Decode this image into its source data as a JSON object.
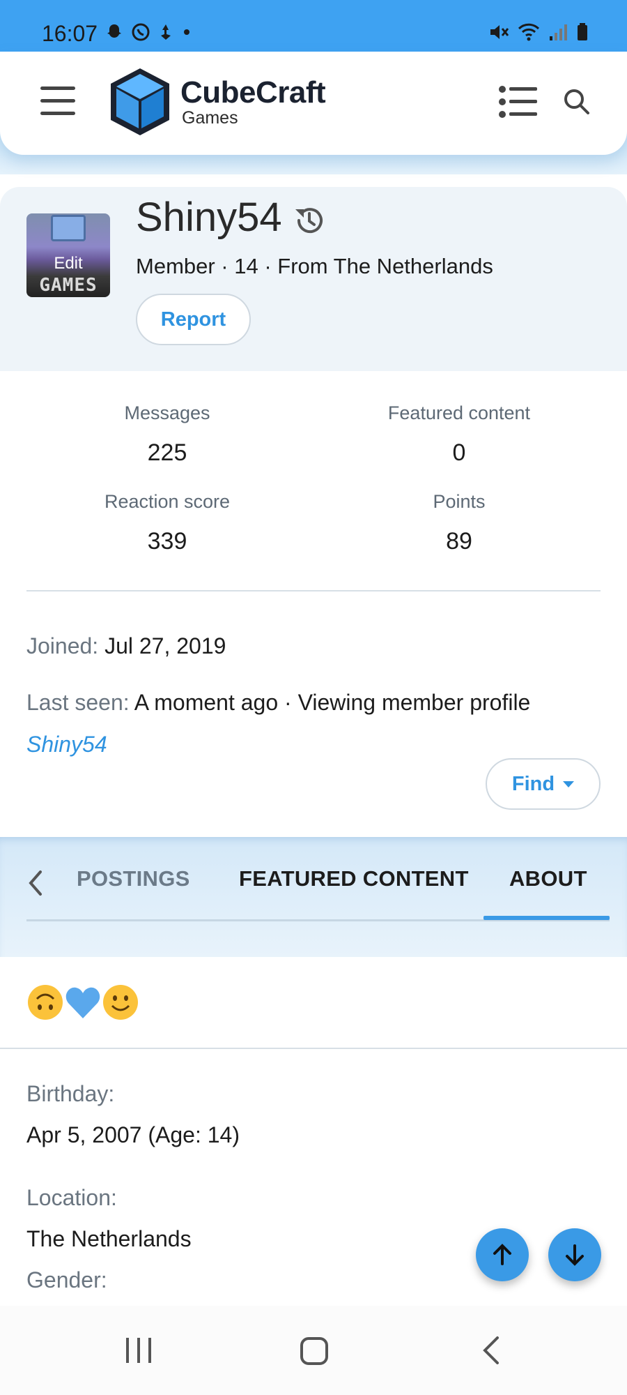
{
  "status_bar": {
    "time": "16:07"
  },
  "header": {
    "logo_title": "CubeCraft",
    "logo_subtitle": "Games"
  },
  "profile": {
    "avatar_text": "GAMES",
    "avatar_edit_label": "Edit",
    "username": "Shiny54",
    "member_line": "Member · 14 · From The Netherlands",
    "report_label": "Report"
  },
  "stats": [
    {
      "label": "Messages",
      "value": "225"
    },
    {
      "label": "Featured content",
      "value": "0"
    },
    {
      "label": "Reaction score",
      "value": "339"
    },
    {
      "label": "Points",
      "value": "89"
    }
  ],
  "joined": {
    "label": "Joined:",
    "value": "Jul 27, 2019"
  },
  "last_seen": {
    "label": "Last seen:",
    "value": "A moment ago · Viewing member profile",
    "link": "Shiny54"
  },
  "find_label": "Find",
  "tabs": [
    {
      "label": "POSTINGS",
      "active": false
    },
    {
      "label": "FEATURED CONTENT",
      "active": false
    },
    {
      "label": "ABOUT",
      "active": true
    }
  ],
  "about": {
    "emojis": "🙃💙🙂",
    "birthday_label": "Birthday:",
    "birthday_value": "Apr 5, 2007 (Age: 14)",
    "location_label": "Location:",
    "location_value": "The Netherlands",
    "gender_label": "Gender:"
  },
  "colors": {
    "accent": "#3a9ae6",
    "status_bar": "#3ea2f2",
    "profile_bg": "#eef4f9"
  }
}
